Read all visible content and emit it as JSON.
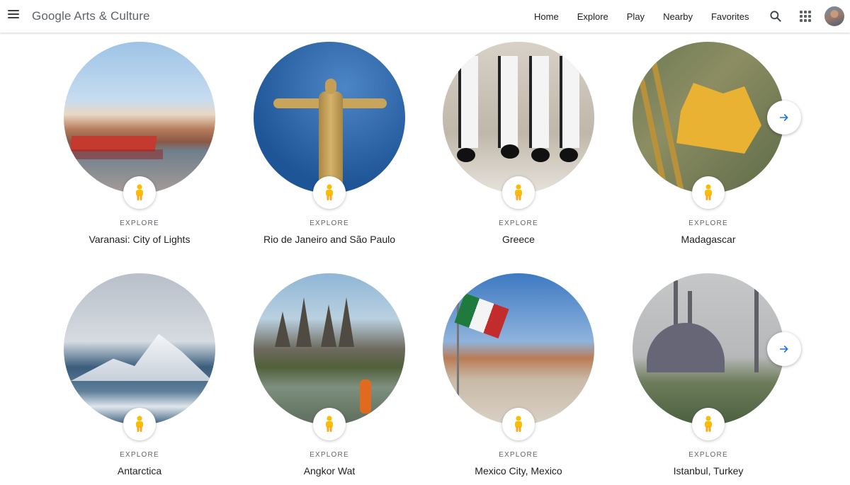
{
  "header": {
    "brand": "Google Arts & Culture",
    "nav": [
      "Home",
      "Explore",
      "Play",
      "Nearby",
      "Favorites"
    ]
  },
  "icons": {
    "menu": "menu-icon",
    "search": "search-icon",
    "apps": "apps-grid-icon",
    "badge": "pegman-icon",
    "next": "arrow-right-icon"
  },
  "colors": {
    "accent": "#1a73e8",
    "pegman": "#fbbc04",
    "text": "#202124",
    "muted": "#5f6368"
  },
  "rows": [
    {
      "cards": [
        {
          "kicker": "EXPLORE",
          "title": "Varanasi: City of Lights"
        },
        {
          "kicker": "EXPLORE",
          "title": "Rio de Janeiro and São Paulo"
        },
        {
          "kicker": "EXPLORE",
          "title": "Greece"
        },
        {
          "kicker": "EXPLORE",
          "title": "Madagascar"
        }
      ]
    },
    {
      "cards": [
        {
          "kicker": "EXPLORE",
          "title": "Antarctica"
        },
        {
          "kicker": "EXPLORE",
          "title": "Angkor Wat"
        },
        {
          "kicker": "EXPLORE",
          "title": "Mexico City, Mexico"
        },
        {
          "kicker": "EXPLORE",
          "title": "Istanbul, Turkey"
        }
      ]
    }
  ]
}
